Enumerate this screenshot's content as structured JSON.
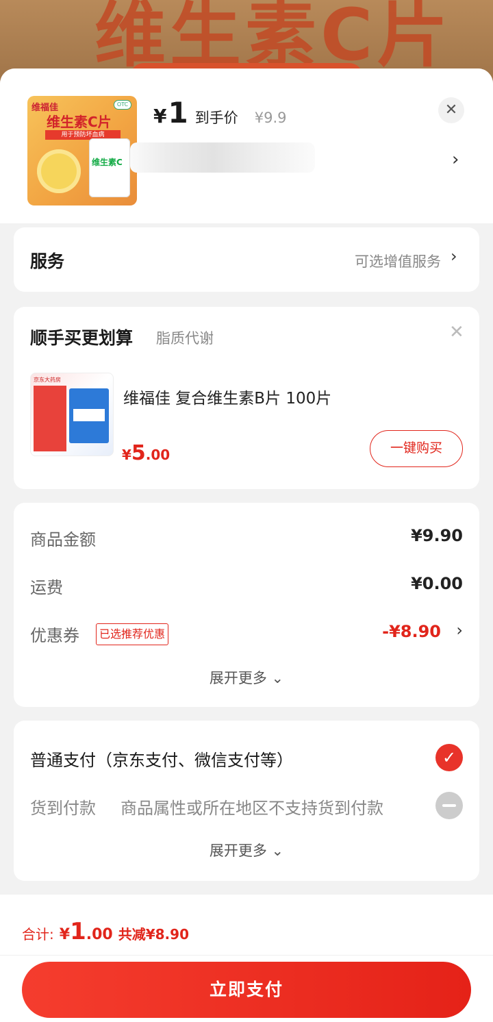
{
  "product": {
    "price_symbol": "¥",
    "price_int": "1",
    "price_label": "到手价",
    "original_price": "¥9.9",
    "thumb_brand": "维福佳",
    "thumb_name": "维生素C片",
    "thumb_ribbon": "用于预防坏血病",
    "thumb_otc": "OTC",
    "thumb_bottle": "维生素C"
  },
  "service": {
    "title": "服务",
    "value": "可选增值服务"
  },
  "bundle": {
    "title": "顺手买更划算",
    "subtitle": "脂质代谢",
    "thumb_store": "京东大药房",
    "item_name": "维福佳 复合维生素B片 100片",
    "price_symbol": "¥",
    "price_int": "5",
    "price_dec": ".00",
    "buy_label": "一键购买"
  },
  "amounts": {
    "goods_label": "商品金额",
    "goods_value": "¥9.90",
    "shipping_label": "运费",
    "shipping_value": "¥0.00",
    "coupon_label": "优惠券",
    "coupon_tag": "已选推荐优惠",
    "coupon_value": "-¥8.90",
    "more_label": "展开更多"
  },
  "payment": {
    "normal_label": "普通支付（京东支付、微信支付等）",
    "cod_label": "货到付款",
    "cod_note": "商品属性或所在地区不支持货到付款",
    "more_label": "展开更多"
  },
  "footer": {
    "total_label": "合计:",
    "total_symbol": "¥",
    "total_int": "1",
    "total_dec": ".00",
    "saved": "共减¥8.90",
    "pay_label": "立即支付"
  },
  "background": {
    "banner_title": "维生素C片"
  },
  "colors": {
    "accent": "#e1251b",
    "page_bg": "#f2f2f2"
  }
}
